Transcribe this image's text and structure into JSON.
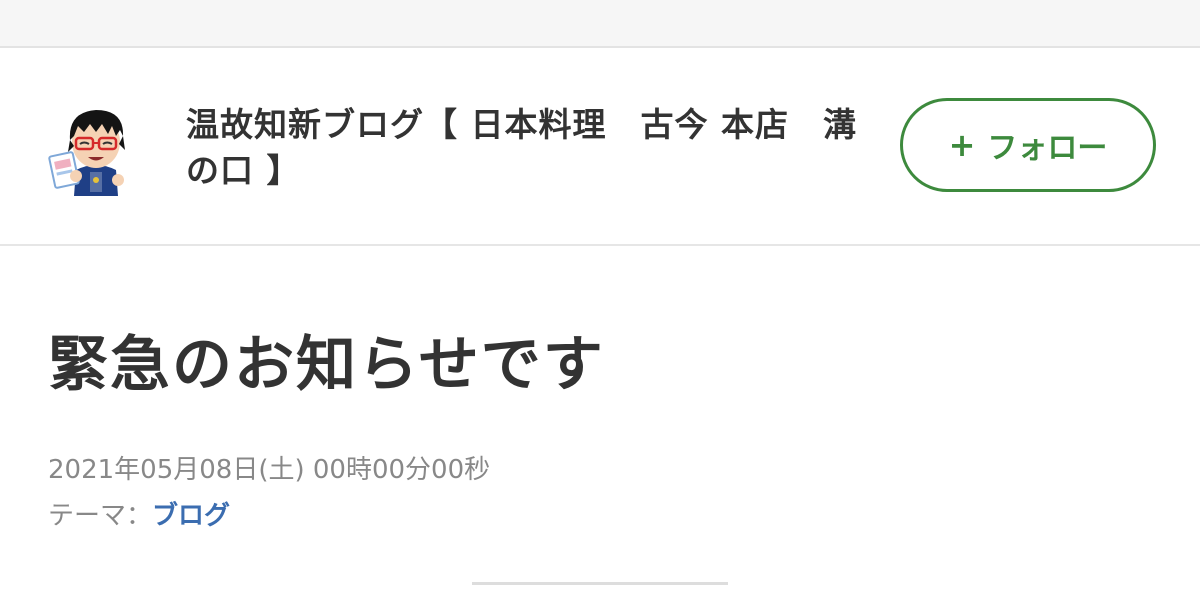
{
  "header": {
    "blog_title": "温故知新ブログ【 日本料理　古今 本店　溝の口 】",
    "follow_plus": "+",
    "follow_label": "フォロー"
  },
  "article": {
    "title": "緊急のお知らせです",
    "date": "2021年05月08日(土) 00時00分00秒",
    "theme_label": "テーマ：",
    "theme_link": "ブログ"
  },
  "colors": {
    "accent_green": "#3d8a3d",
    "link_blue": "#3b6db0",
    "text_dark": "#333333",
    "text_gray": "#888888"
  }
}
